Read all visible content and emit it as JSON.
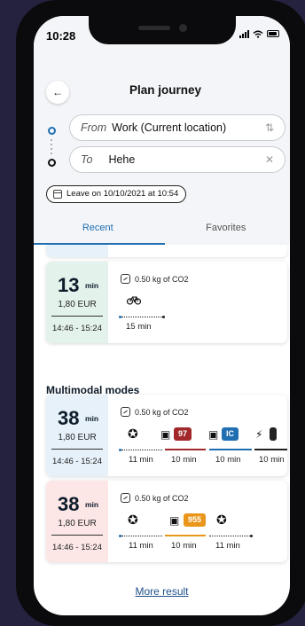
{
  "status_bar": {
    "time": "10:28"
  },
  "header": {
    "title": "Plan journey"
  },
  "from_field": {
    "label": "From",
    "value": "Work (Current location)",
    "icon": "swap-icon"
  },
  "to_field": {
    "label": "To",
    "value": "Hehe",
    "icon": "clear-icon"
  },
  "leave_chip": {
    "label": "Leave on 10/10/2021 at 10:54",
    "icon": "calendar-icon"
  },
  "tabs": [
    {
      "label": "Recent",
      "active": true
    },
    {
      "label": "Favorites",
      "active": false
    }
  ],
  "recent_card": {
    "duration": "13",
    "unit": "min",
    "price": "1,80 EUR",
    "times": "14:46 - 15:24",
    "co2": "0.50 kg of CO2",
    "modes": [
      "bike-icon"
    ],
    "segment_labels": [
      "15 min"
    ]
  },
  "multimodal_title": "Multimodal modes",
  "multimodal_cards": [
    {
      "duration": "38",
      "unit": "min",
      "price": "1,80 EUR",
      "times": "14:46 - 15:24",
      "co2": "0.50 kg of CO2",
      "badges": [
        {
          "text": "97",
          "color": "#a3282c"
        },
        {
          "text": "IC",
          "color": "#1f6fb2"
        }
      ],
      "segment_labels": [
        "11 min",
        "10 min",
        "10 min",
        "10 min"
      ]
    },
    {
      "duration": "38",
      "unit": "min",
      "price": "1,80 EUR",
      "times": "14:46 - 15:24",
      "co2": "0.50 kg of CO2",
      "badges": [
        {
          "text": "955",
          "color": "#e9961a"
        }
      ],
      "segment_labels": [
        "11 min",
        "10 min",
        "11 min"
      ]
    }
  ],
  "more_link": "More result",
  "colors": {
    "accent": "#1f6fb2",
    "background": "#24223f"
  }
}
